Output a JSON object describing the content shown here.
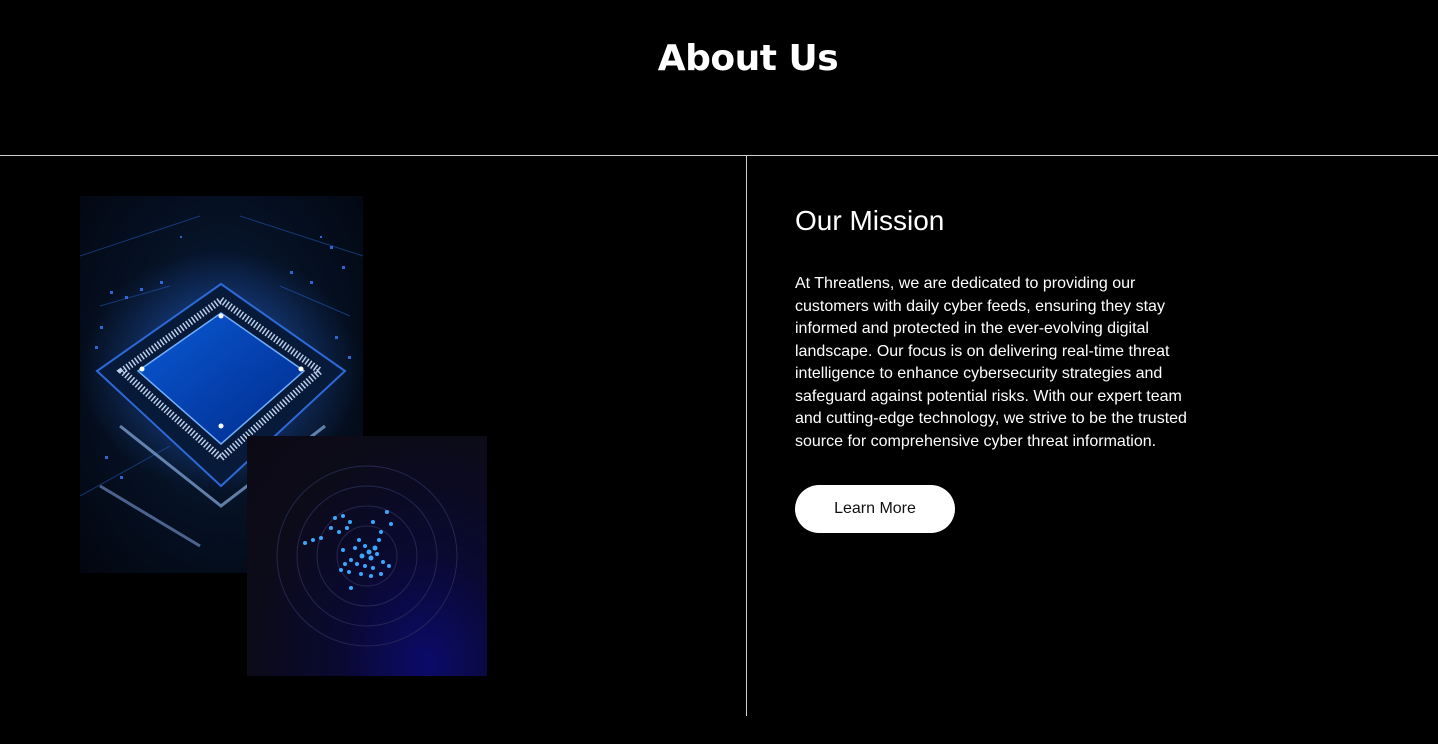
{
  "page": {
    "title": "About Us",
    "background_color": "#000000",
    "text_color": "#ffffff",
    "divider_color": "#cfcfcf"
  },
  "images": {
    "chip": {
      "icon": "circuit-chip-illustration",
      "accent_color": "#1e6dff"
    },
    "radar": {
      "icon": "radar-dots-illustration",
      "accent_color": "#3aa8ff"
    }
  },
  "mission": {
    "heading": "Our Mission",
    "body": "At Threatlens, we are dedicated to providing our customers with daily cyber feeds, ensuring they stay informed and protected in the ever-evolving digital landscape. Our focus is on delivering real-time threat intelligence to enhance cybersecurity strategies and safeguard against potential risks. With our expert team and cutting-edge technology, we strive to be the trusted source for comprehensive cyber threat information.",
    "button_label": "Learn More",
    "button_color": "#ffffff"
  }
}
